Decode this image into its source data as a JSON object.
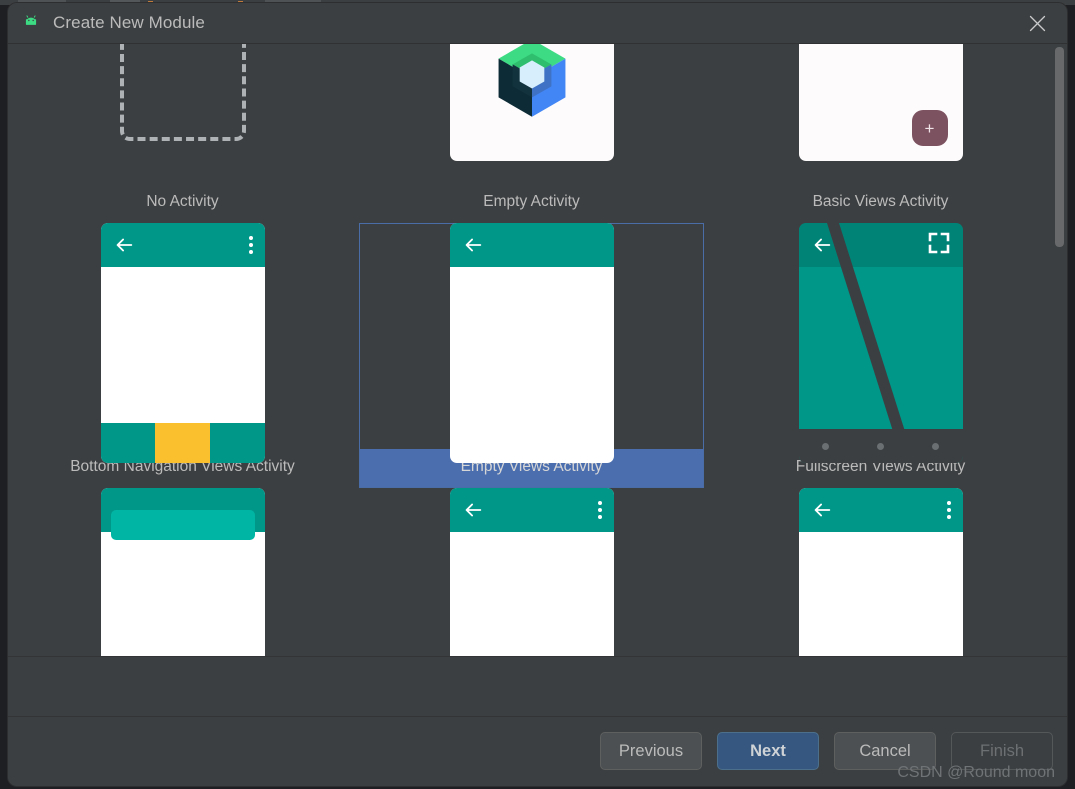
{
  "window": {
    "title": "Create New Module",
    "app_icon": "android-robot-icon",
    "close_icon": "close-icon"
  },
  "template_gallery": {
    "scroll_position": "partially-scrolled",
    "selected_template": "Empty Views Activity",
    "rows": [
      {
        "items": [
          {
            "label": "No Activity",
            "thumb": "dashed-placeholder",
            "selected": false
          },
          {
            "label": "Empty Activity",
            "thumb": "jetpack-compose-logo",
            "selected": false
          },
          {
            "label": "Basic Views Activity",
            "thumb": "white-card-with-fab",
            "selected": false
          }
        ]
      },
      {
        "items": [
          {
            "label": "Bottom Navigation Views Activity",
            "thumb": "phone-bottom-nav",
            "selected": false
          },
          {
            "label": "Empty Views Activity",
            "thumb": "phone-empty",
            "selected": true
          },
          {
            "label": "Fullscreen Views Activity",
            "thumb": "phone-fullscreen",
            "selected": false
          }
        ]
      },
      {
        "items": [
          {
            "label": "",
            "thumb": "phone-partial",
            "selected": false
          },
          {
            "label": "",
            "thumb": "phone-partial",
            "selected": false
          },
          {
            "label": "",
            "thumb": "phone-partial",
            "selected": false
          }
        ]
      }
    ]
  },
  "footer": {
    "previous_label": "Previous",
    "next_label": "Next",
    "cancel_label": "Cancel",
    "finish_label": "Finish",
    "finish_disabled": true
  },
  "watermark": "CSDN @Round moon",
  "colors": {
    "dialog_bg": "#3c3f41",
    "text": "#bbbbbb",
    "selection_blue": "#4b6eaf",
    "selection_border": "#4a6da7",
    "primary_button": "#365880",
    "android_green": "#3ddc84",
    "material_teal": "#009688",
    "accent_yellow": "#fbc02d",
    "fab_mauve": "#7d5260",
    "card_white": "#fdfbfc"
  }
}
